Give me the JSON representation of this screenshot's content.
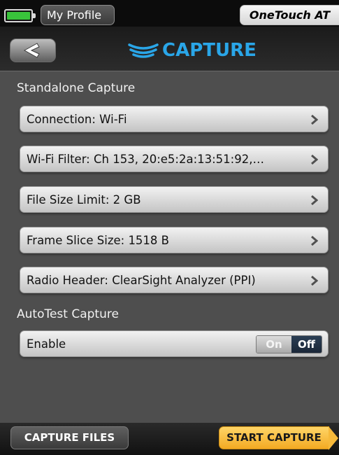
{
  "status_bar": {
    "battery_icon": "battery-full-icon",
    "battery_color": "#39c33b",
    "profile_label": "My Profile",
    "device_name": "OneTouch AT"
  },
  "header": {
    "back_icon": "chevron-left-icon",
    "title_icon": "capture-waves-icon",
    "title": "CAPTURE",
    "title_color": "#2aa6e8"
  },
  "standalone": {
    "section_label": "Standalone Capture",
    "rows": [
      {
        "label": "Connection: Wi-Fi"
      },
      {
        "label": "Wi-Fi Filter: Ch 153, 20:e5:2a:13:51:92,…"
      },
      {
        "label": "File Size Limit: 2 GB"
      },
      {
        "label": "Frame Slice Size: 1518 B"
      },
      {
        "label": "Radio Header: ClearSight Analyzer (PPI)"
      }
    ]
  },
  "autotest": {
    "section_label": "AutoTest Capture",
    "enable_label": "Enable",
    "toggle_on_label": "On",
    "toggle_off_label": "Off",
    "selected": "Off"
  },
  "footer": {
    "capture_files_label": "CAPTURE FILES",
    "start_capture_label": "START CAPTURE",
    "start_capture_color": "#f3aa23"
  }
}
